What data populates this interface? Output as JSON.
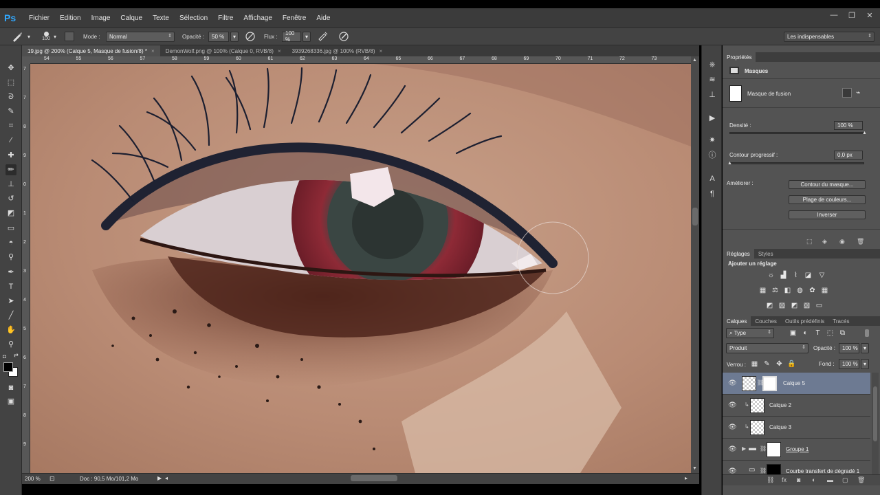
{
  "app": {
    "logo": "Ps"
  },
  "menu": [
    "Fichier",
    "Edition",
    "Image",
    "Calque",
    "Texte",
    "Sélection",
    "Filtre",
    "Affichage",
    "Fenêtre",
    "Aide"
  ],
  "window_controls": {
    "minimize": "—",
    "restore": "❐",
    "close": "✕"
  },
  "options": {
    "brush_size": "100",
    "mode_label": "Mode :",
    "mode_value": "Normal",
    "opacity_label": "Opacité :",
    "opacity_value": "50 %",
    "flow_label": "Flux :",
    "flow_value": "100 %",
    "workspace": "Les indispensables"
  },
  "tabs": [
    {
      "label": "19.jpg @ 200% (Calque 5, Masque de fusion/8) *",
      "close": "×"
    },
    {
      "label": "DemonWolf.png @ 100% (Calque 0, RVB/8)",
      "close": "×"
    },
    {
      "label": "3939268336.jpg @ 100% (RVB/8)",
      "close": "×"
    }
  ],
  "ruler": {
    "h": [
      "54",
      "55",
      "56",
      "57",
      "58",
      "59",
      "60",
      "61",
      "62",
      "63",
      "64",
      "65",
      "66",
      "67",
      "68",
      "69",
      "70",
      "71",
      "72",
      "73"
    ],
    "v": [
      "7",
      "7",
      "8",
      "9",
      "0",
      "1",
      "2",
      "3",
      "4",
      "5",
      "6",
      "7",
      "8",
      "9"
    ]
  },
  "status": {
    "zoom": "200 %",
    "doc": "Doc : 90,5 Mo/101,2 Mo"
  },
  "properties": {
    "title": "Propriétés",
    "section": "Masques",
    "mask_type": "Masque de fusion",
    "density_label": "Densité :",
    "density_value": "100 %",
    "feather_label": "Contour progressif :",
    "feather_value": "0,0 px",
    "refine_label": "Améliorer :",
    "btn_edge": "Contour du masque...",
    "btn_color": "Plage de couleurs...",
    "btn_invert": "Inverser"
  },
  "adjustments": {
    "tab1": "Réglages",
    "tab2": "Styles",
    "title": "Ajouter un réglage"
  },
  "layers_panel": {
    "tabs": [
      "Calques",
      "Couches",
      "Outils prédéfinis",
      "Tracés"
    ],
    "filter": "Type",
    "blend_mode": "Produit",
    "opacity_label": "Opacité :",
    "opacity_value": "100 %",
    "lock_label": "Verrou :",
    "fill_label": "Fond :",
    "fill_value": "100 %",
    "layers": [
      {
        "name": "Calque 5"
      },
      {
        "name": "Calque 2"
      },
      {
        "name": "Calque 3"
      },
      {
        "name": "Groupe 1"
      },
      {
        "name": "Courbe transfert de dégradé 1"
      }
    ]
  }
}
